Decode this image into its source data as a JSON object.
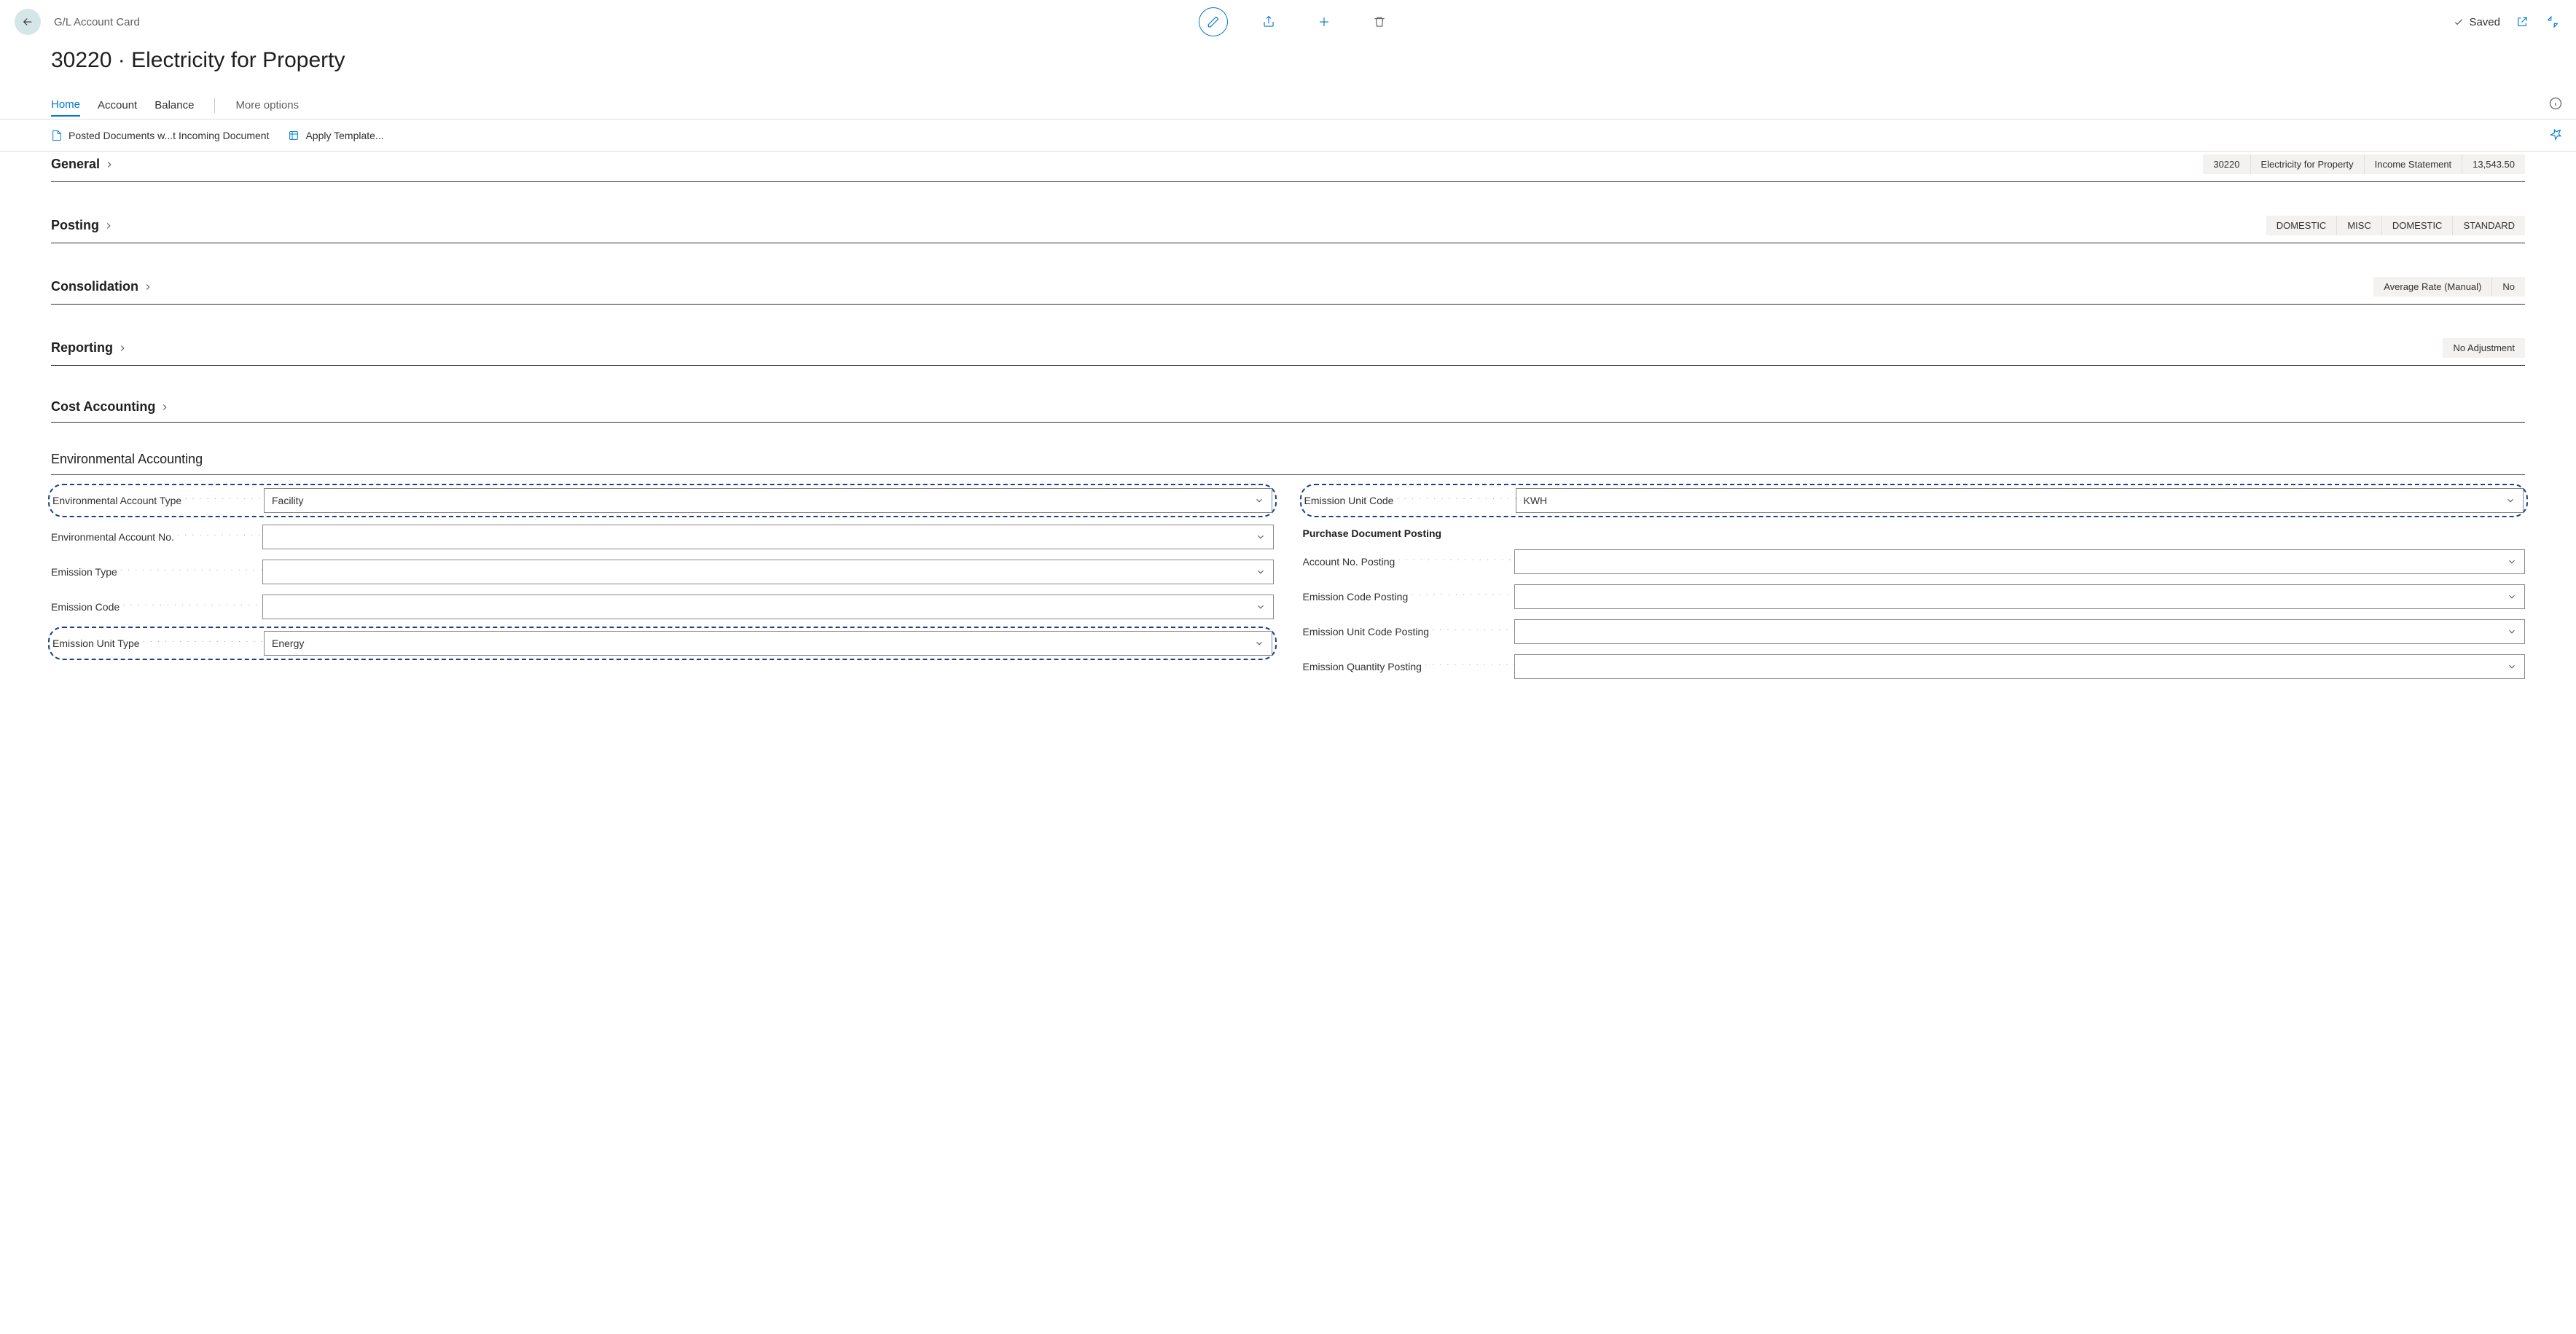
{
  "breadcrumb": "G/L Account Card",
  "page_title": "30220 · Electricity for Property",
  "saved_label": "Saved",
  "tabs": {
    "home": "Home",
    "account": "Account",
    "balance": "Balance",
    "more": "More options"
  },
  "actions": {
    "posted_docs": "Posted Documents w...t Incoming Document",
    "apply_template": "Apply Template..."
  },
  "fasttabs": {
    "general": {
      "title": "General",
      "summary": [
        "30220",
        "Electricity for Property",
        "Income Statement",
        "13,543.50"
      ]
    },
    "posting": {
      "title": "Posting",
      "summary": [
        "DOMESTIC",
        "MISC",
        "DOMESTIC",
        "STANDARD"
      ]
    },
    "consolidation": {
      "title": "Consolidation",
      "summary": [
        "Average Rate (Manual)",
        "No"
      ]
    },
    "reporting": {
      "title": "Reporting",
      "summary": [
        "No Adjustment"
      ]
    },
    "cost_accounting": {
      "title": "Cost Accounting",
      "summary": []
    }
  },
  "env": {
    "title": "Environmental Accounting",
    "left": {
      "acct_type": {
        "label": "Environmental Account Type",
        "value": "Facility"
      },
      "acct_no": {
        "label": "Environmental Account No.",
        "value": ""
      },
      "emission_type": {
        "label": "Emission Type",
        "value": ""
      },
      "emission_code": {
        "label": "Emission Code",
        "value": ""
      },
      "unit_type": {
        "label": "Emission Unit Type",
        "value": "Energy"
      }
    },
    "right": {
      "unit_code": {
        "label": "Emission Unit Code",
        "value": "KWH"
      },
      "subsection": "Purchase Document Posting",
      "acct_no_posting": {
        "label": "Account No. Posting",
        "value": ""
      },
      "code_posting": {
        "label": "Emission Code Posting",
        "value": ""
      },
      "unit_code_posting": {
        "label": "Emission Unit Code Posting",
        "value": ""
      },
      "qty_posting": {
        "label": "Emission Quantity Posting",
        "value": ""
      }
    }
  }
}
